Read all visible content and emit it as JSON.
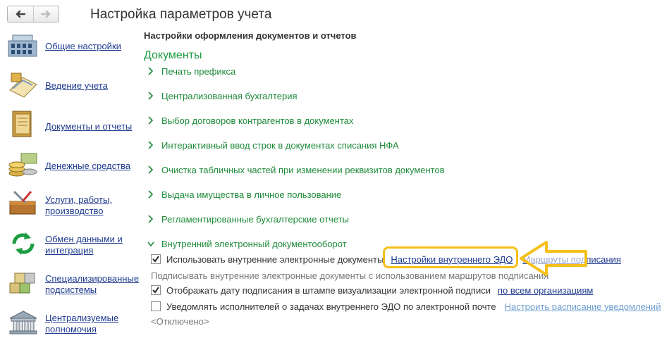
{
  "window": {
    "title": "Настройка параметров учета"
  },
  "nav": {
    "back_icon": "arrow-left-icon",
    "forward_icon": "arrow-right-icon"
  },
  "sidebar": {
    "items": [
      {
        "label": "Общие настройки",
        "icon": "building-icon"
      },
      {
        "label": "Ведение учета",
        "icon": "ledger-icon"
      },
      {
        "label": "Документы и отчеты",
        "icon": "folder-icon"
      },
      {
        "label": "Денежные средства",
        "icon": "coins-icon"
      },
      {
        "label": "Услуги, работы, производство",
        "icon": "toolbox-icon"
      },
      {
        "label": "Обмен данными и интеграция",
        "icon": "sync-arrows-icon"
      },
      {
        "label": "Специализированные подсистемы",
        "icon": "cubes-icon"
      },
      {
        "label": "Централизуемые полномочия",
        "icon": "government-building-icon"
      }
    ]
  },
  "main": {
    "section_title": "Настройки оформления документов и отчетов",
    "group_title": "Документы",
    "groups": [
      {
        "label": "Печать префикса",
        "expanded": false
      },
      {
        "label": "Централизованная бухгалтерия",
        "expanded": false
      },
      {
        "label": "Выбор договоров контрагентов в документах",
        "expanded": false
      },
      {
        "label": "Интерактивный ввод строк в документах списания НФА",
        "expanded": false
      },
      {
        "label": "Очистка табличных частей при изменении реквизитов документов",
        "expanded": false
      },
      {
        "label": "Выдача имущества в личное пользование",
        "expanded": false
      },
      {
        "label": "Регламентированные бухгалтерские отчеты",
        "expanded": false
      },
      {
        "label": "Внутренний электронный документооборот",
        "expanded": true
      }
    ],
    "edo": {
      "use_edo": {
        "label": "Использовать внутренние электронные документы",
        "checked": true
      },
      "settings_link": "Настройки внутреннего ЭДО",
      "routes_link": "Маршруты подписания",
      "hint": "Подписывать внутренние электронные документы с использованием маршрутов подписания",
      "show_date": {
        "label": "Отображать дату подписания в штампе визуализации электронной подписи",
        "checked": true
      },
      "orgs_link": "по всем организациям",
      "notify": {
        "label": "Уведомлять исполнителей о задачах внутреннего ЭДО по электронной почте",
        "checked": false
      },
      "schedule_link": "Настроить расписание уведомлений",
      "disabled_hint": "<Отключено>"
    }
  },
  "colors": {
    "highlight": "#f5c019",
    "group_green": "#1e8a3a",
    "link_blue": "#1f3b8f"
  }
}
